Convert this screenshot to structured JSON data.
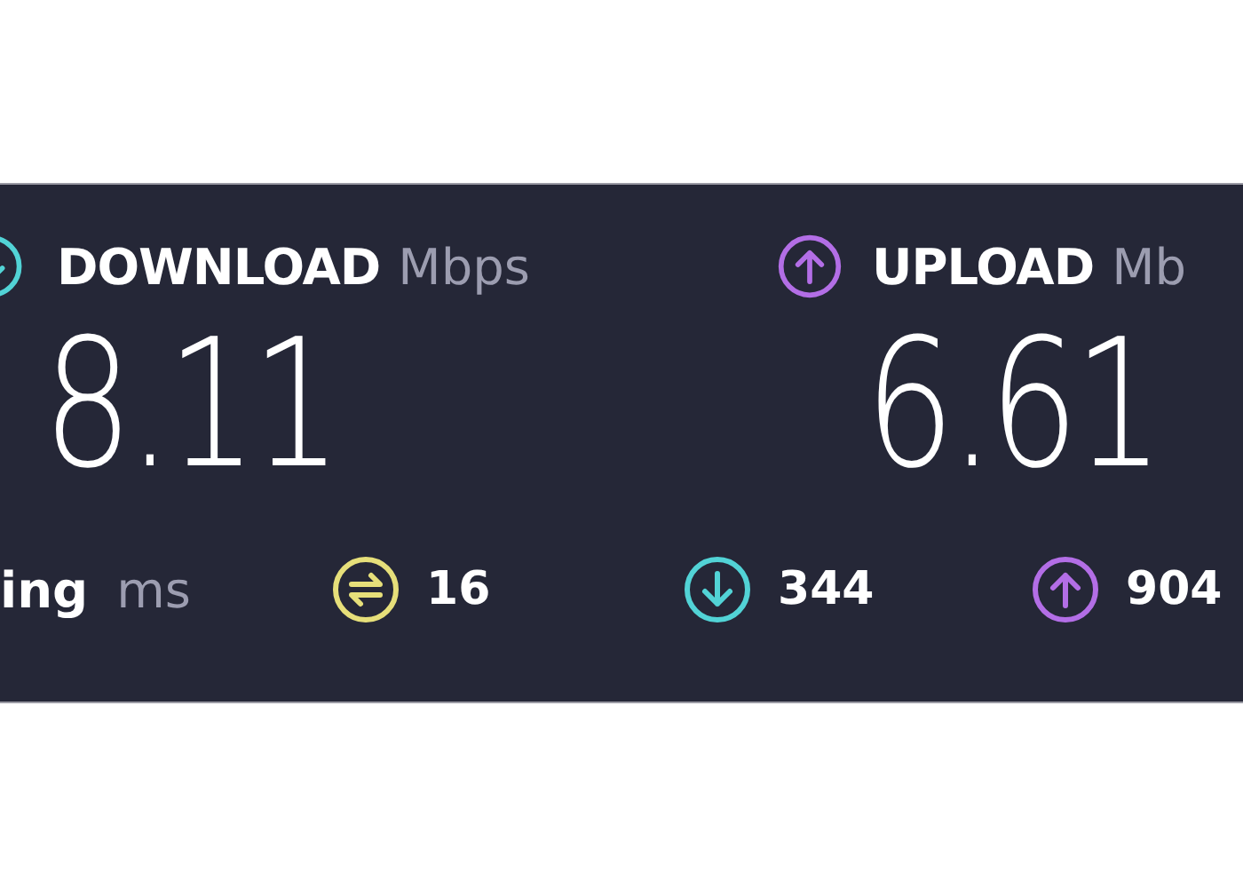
{
  "metrics": [
    {
      "kind": "download",
      "label": "DOWNLOAD",
      "unit": "Mbps",
      "value": "8.11"
    },
    {
      "kind": "upload",
      "label": "UPLOAD",
      "unit": "Mb",
      "value": "6.61"
    }
  ],
  "ping": {
    "label": "ing",
    "unit": "ms",
    "readings": [
      {
        "kind": "jitter",
        "value": "16"
      },
      {
        "kind": "download",
        "value": "344"
      },
      {
        "kind": "upload",
        "value": "904"
      }
    ]
  }
}
